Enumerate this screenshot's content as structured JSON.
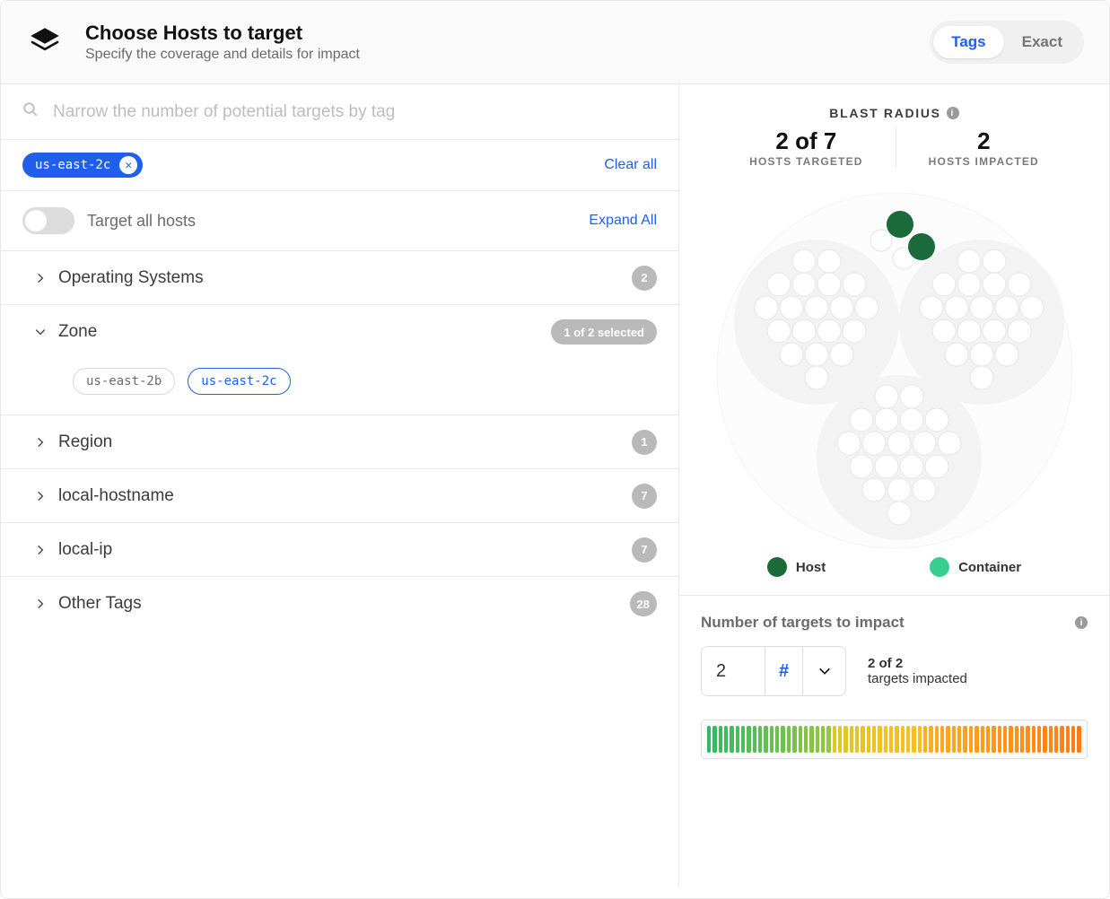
{
  "header": {
    "title": "Choose Hosts to target",
    "subtitle": "Specify the coverage and details for impact",
    "tabs": {
      "tags": "Tags",
      "exact": "Exact"
    }
  },
  "search": {
    "placeholder": "Narrow the number of potential targets by tag"
  },
  "filters": {
    "chips": [
      "us-east-2c"
    ],
    "clear_all": "Clear all"
  },
  "toggle": {
    "label": "Target all hosts",
    "expand_all": "Expand All"
  },
  "accordions": {
    "os": {
      "label": "Operating Systems",
      "count": "2"
    },
    "zone": {
      "label": "Zone",
      "selected_text": "1 of 2 selected",
      "options": [
        "us-east-2b",
        "us-east-2c"
      ],
      "selected_index": 1
    },
    "region": {
      "label": "Region",
      "count": "1"
    },
    "hostname": {
      "label": "local-hostname",
      "count": "7"
    },
    "localip": {
      "label": "local-ip",
      "count": "7"
    },
    "other": {
      "label": "Other Tags",
      "count": "28"
    }
  },
  "blast": {
    "title": "BLAST RADIUS",
    "targeted_value": "2 of 7",
    "targeted_label": "HOSTS TARGETED",
    "impacted_value": "2",
    "impacted_label": "HOSTS IMPACTED",
    "legend": {
      "host": "Host",
      "host_color": "#1b6b3a",
      "container": "Container",
      "container_color": "#37cf8f"
    }
  },
  "impact": {
    "title": "Number of targets to impact",
    "value": "2",
    "unit": "#",
    "summary_count": "2 of 2",
    "summary_label": "targets impacted"
  }
}
